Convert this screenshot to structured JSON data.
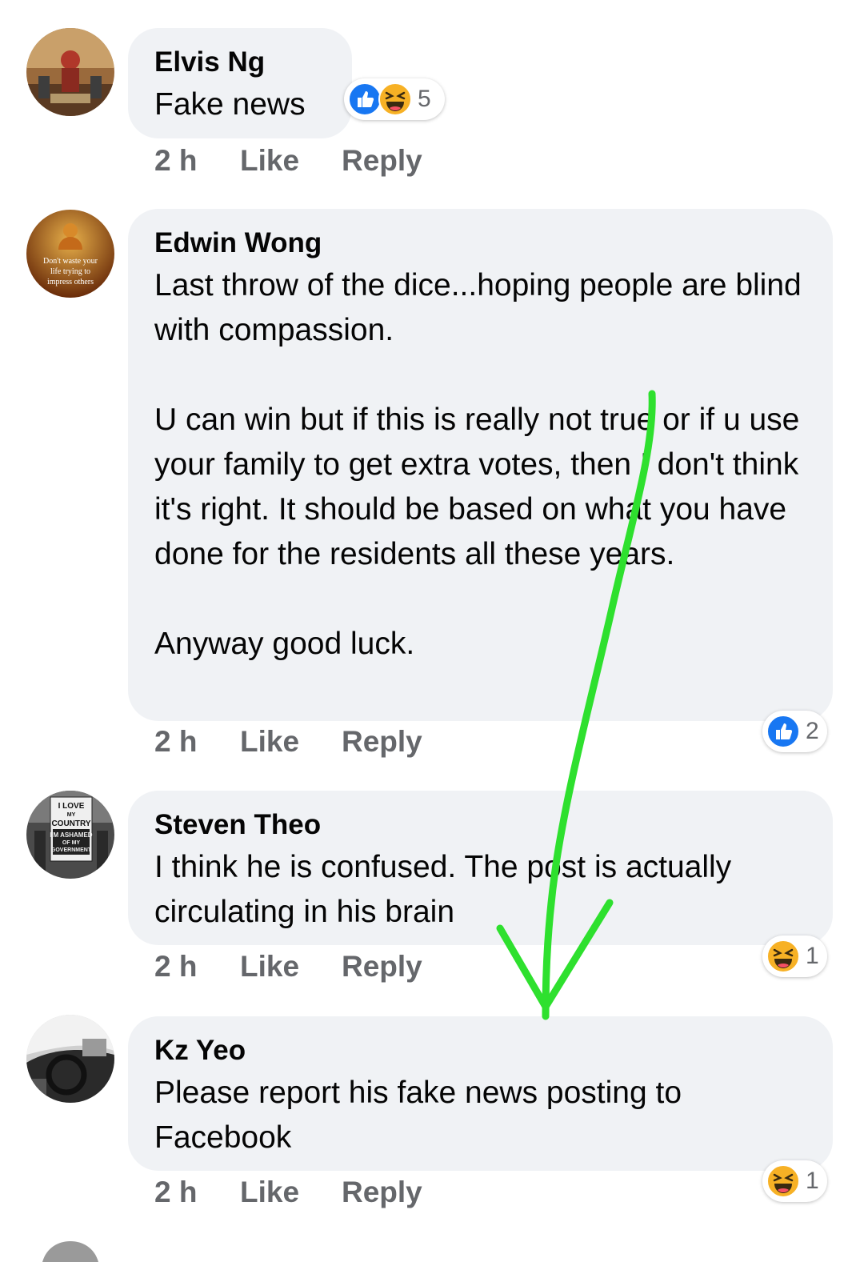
{
  "comments": [
    {
      "author": "Elvis Ng",
      "text": "Fake news",
      "time": "2 h",
      "like": "Like",
      "reply": "Reply",
      "reactions": {
        "types": [
          "like-icon",
          "haha-icon"
        ],
        "count": "5"
      }
    },
    {
      "author": "Edwin Wong",
      "avatar_caption": "Don't waste your life trying to impress others",
      "text": "Last throw of the dice...hoping people are blind with compassion.\n\nU can win but if this is really not true or if u use your family to get extra votes, then I don't think it's right. It should be based on what you have done for the residents all these years.\n\nAnyway good luck.",
      "time": "2 h",
      "like": "Like",
      "reply": "Reply",
      "reactions": {
        "types": [
          "like-icon"
        ],
        "count": "2"
      }
    },
    {
      "author": "Steven Theo",
      "avatar_caption": "I LOVE MY COUNTRY I'M ASHAMED OF MY GOVERNMENT",
      "text": "I think he is confused. The post is actually circulating in his brain",
      "time": "2 h",
      "like": "Like",
      "reply": "Reply",
      "reactions": {
        "types": [
          "haha-icon"
        ],
        "count": "1"
      }
    },
    {
      "author": "Kz Yeo",
      "text": "Please report his fake news posting to Facebook",
      "time": "2 h",
      "like": "Like",
      "reply": "Reply",
      "reactions": {
        "types": [
          "haha-icon"
        ],
        "count": "1"
      }
    }
  ],
  "colors": {
    "bubble": "#f0f2f5",
    "meta_text": "#65676b",
    "like_blue": "#1877f2",
    "haha_yellow": "#f7b125",
    "annotation_arrow": "#2ee02e"
  }
}
